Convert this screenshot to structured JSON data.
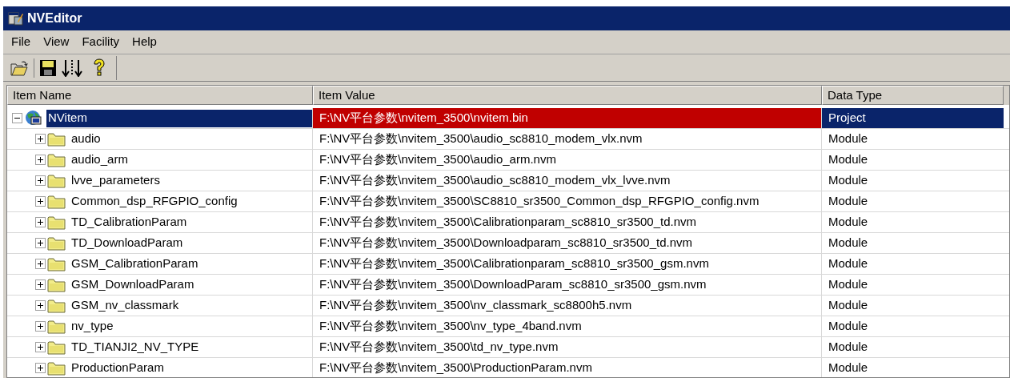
{
  "window": {
    "title": "NVEditor"
  },
  "menu": [
    "File",
    "View",
    "Facility",
    "Help"
  ],
  "columns": [
    "Item Name",
    "Item Value",
    "Data Type"
  ],
  "tree": {
    "name": "NVitem",
    "value": "F:\\NV平台参数\\nvitem_3500\\nvitem.bin",
    "type": "Project",
    "expanded": true,
    "selected": true,
    "children": [
      {
        "name": "audio",
        "value": "F:\\NV平台参数\\nvitem_3500\\audio_sc8810_modem_vlx.nvm",
        "type": "Module",
        "expanded": false,
        "selected": false
      },
      {
        "name": "audio_arm",
        "value": "F:\\NV平台参数\\nvitem_3500\\audio_arm.nvm",
        "type": "Module",
        "expanded": false,
        "selected": false
      },
      {
        "name": "lvve_parameters",
        "value": "F:\\NV平台参数\\nvitem_3500\\audio_sc8810_modem_vlx_lvve.nvm",
        "type": "Module",
        "expanded": false,
        "selected": false
      },
      {
        "name": "Common_dsp_RFGPIO_config",
        "value": "F:\\NV平台参数\\nvitem_3500\\SC8810_sr3500_Common_dsp_RFGPIO_config.nvm",
        "type": "Module",
        "expanded": false,
        "selected": false
      },
      {
        "name": "TD_CalibrationParam",
        "value": "F:\\NV平台参数\\nvitem_3500\\Calibrationparam_sc8810_sr3500_td.nvm",
        "type": "Module",
        "expanded": false,
        "selected": false
      },
      {
        "name": "TD_DownloadParam",
        "value": "F:\\NV平台参数\\nvitem_3500\\Downloadparam_sc8810_sr3500_td.nvm",
        "type": "Module",
        "expanded": false,
        "selected": false
      },
      {
        "name": "GSM_CalibrationParam",
        "value": "F:\\NV平台参数\\nvitem_3500\\Calibrationparam_sc8810_sr3500_gsm.nvm",
        "type": "Module",
        "expanded": false,
        "selected": false
      },
      {
        "name": "GSM_DownloadParam",
        "value": "F:\\NV平台参数\\nvitem_3500\\DownloadParam_sc8810_sr3500_gsm.nvm",
        "type": "Module",
        "expanded": false,
        "selected": false
      },
      {
        "name": "GSM_nv_classmark",
        "value": "F:\\NV平台参数\\nvitem_3500\\nv_classmark_sc8800h5.nvm",
        "type": "Module",
        "expanded": false,
        "selected": false
      },
      {
        "name": "nv_type",
        "value": "F:\\NV平台参数\\nvitem_3500\\nv_type_4band.nvm",
        "type": "Module",
        "expanded": false,
        "selected": false
      },
      {
        "name": "TD_TIANJI2_NV_TYPE",
        "value": "F:\\NV平台参数\\nvitem_3500\\td_nv_type.nvm",
        "type": "Module",
        "expanded": false,
        "selected": false
      },
      {
        "name": "ProductionParam",
        "value": "F:\\NV平台参数\\nvitem_3500\\ProductionParam.nvm",
        "type": "Module",
        "expanded": false,
        "selected": false
      }
    ]
  }
}
